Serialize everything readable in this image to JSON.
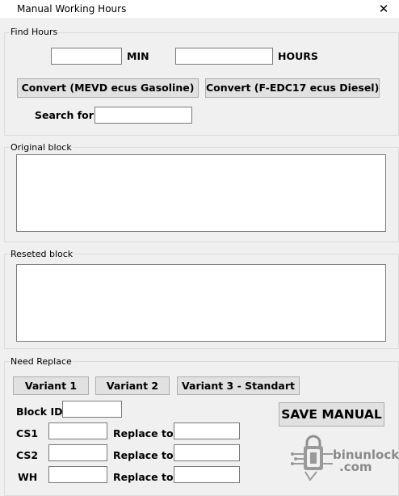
{
  "window": {
    "title": "Manual Working Hours",
    "close_glyph": "✕"
  },
  "find_hours": {
    "group_label": "Find Hours",
    "min_label": "MIN",
    "min_value": "",
    "hours_label": "HOURS",
    "hours_value": "",
    "convert_gasoline_label": "Convert (MEVD ecus Gasoline)",
    "convert_diesel_label": "Convert (F-EDC17 ecus Diesel)",
    "search_label": "Search for",
    "search_value": ""
  },
  "original_block": {
    "group_label": "Original block",
    "value": ""
  },
  "reseted_block": {
    "group_label": "Reseted block",
    "value": ""
  },
  "need_replace": {
    "group_label": "Need Replace",
    "variant1_label": "Variant 1",
    "variant2_label": "Variant 2",
    "variant3_label": "Variant 3 - Standart",
    "block_id_label": "Block ID",
    "block_id_value": "",
    "save_label": "SAVE MANUAL",
    "rows": [
      {
        "label": "CS1",
        "value": "",
        "replace_label": "Replace to",
        "replace_value": ""
      },
      {
        "label": "CS2",
        "value": "",
        "replace_label": "Replace to",
        "replace_value": ""
      },
      {
        "label": "WH",
        "value": "",
        "replace_label": "Replace to",
        "replace_value": ""
      }
    ]
  },
  "watermark": {
    "line1": "binunlock",
    "line2": ".com",
    "icon": "padlock-chip-icon"
  }
}
